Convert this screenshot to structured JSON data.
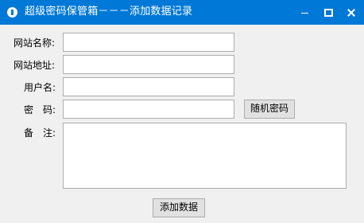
{
  "window": {
    "title": "超级密码保管箱－－－添加数据记录"
  },
  "form": {
    "site_name_label": "网站名称:",
    "site_url_label": "网站地址:",
    "username_label": "用户名:",
    "password_label": "密　码:",
    "remark_label": "备　注:",
    "site_name_value": "",
    "site_url_value": "",
    "username_value": "",
    "password_value": "",
    "remark_value": ""
  },
  "buttons": {
    "random_password": "随机密码",
    "add_data": "添加数据"
  }
}
